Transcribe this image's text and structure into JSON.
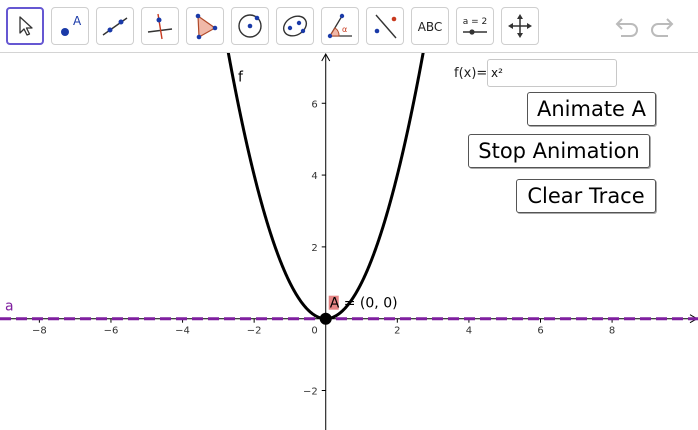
{
  "toolbar": {
    "tools": [
      {
        "name": "move-tool",
        "icon": "cursor-arrow-icon",
        "selected": true
      },
      {
        "name": "point-tool",
        "icon": "point-icon",
        "label": "A"
      },
      {
        "name": "line-tool",
        "icon": "line-through-points-icon"
      },
      {
        "name": "perpendicular-line-tool",
        "icon": "perpendicular-line-icon"
      },
      {
        "name": "polygon-tool",
        "icon": "polygon-icon"
      },
      {
        "name": "circle-center-point-tool",
        "icon": "circle-center-icon"
      },
      {
        "name": "ellipse-tool",
        "icon": "ellipse-icon"
      },
      {
        "name": "angle-tool",
        "icon": "angle-icon"
      },
      {
        "name": "reflect-tool",
        "icon": "reflect-icon"
      },
      {
        "name": "text-tool",
        "icon": "text-icon",
        "label": "ABC"
      },
      {
        "name": "slider-tool",
        "icon": "slider-icon",
        "label": "a = 2"
      },
      {
        "name": "move-graphics-view-tool",
        "icon": "move-arrows-icon"
      }
    ],
    "undo_icon": "undo-icon",
    "redo_icon": "redo-icon"
  },
  "input": {
    "label": "f(x)=",
    "value": "x²"
  },
  "buttons": {
    "animate": "Animate A",
    "stop": "Stop Animation",
    "clear": "Clear Trace"
  },
  "graph": {
    "function_label": "f",
    "line_label": "a",
    "point_label": "A = (0, 0)",
    "colors": {
      "function": "#000000",
      "line": "#7f1f9f",
      "point": "#000000",
      "point_label_highlight": "#e06666",
      "axis": "#000000",
      "selection_accent": "#6557d2"
    }
  },
  "chart_data": {
    "type": "line",
    "title": "",
    "xlabel": "",
    "ylabel": "",
    "xlim": [
      -9.1,
      10.4
    ],
    "ylim": [
      -3.1,
      7.4
    ],
    "x_ticks": [
      -8,
      -6,
      -4,
      -2,
      2,
      4,
      6,
      8
    ],
    "y_ticks": [
      -2,
      2,
      4,
      6
    ],
    "origin_label": "0",
    "grid": false,
    "series": [
      {
        "name": "f",
        "kind": "function",
        "expression": "x²",
        "color": "#000000"
      },
      {
        "name": "a",
        "kind": "horizontal-line",
        "y": 0,
        "color": "#7f1f9f",
        "style": "dashed"
      }
    ],
    "points": [
      {
        "name": "A",
        "x": 0,
        "y": 0,
        "label": "A = (0, 0)"
      }
    ]
  }
}
